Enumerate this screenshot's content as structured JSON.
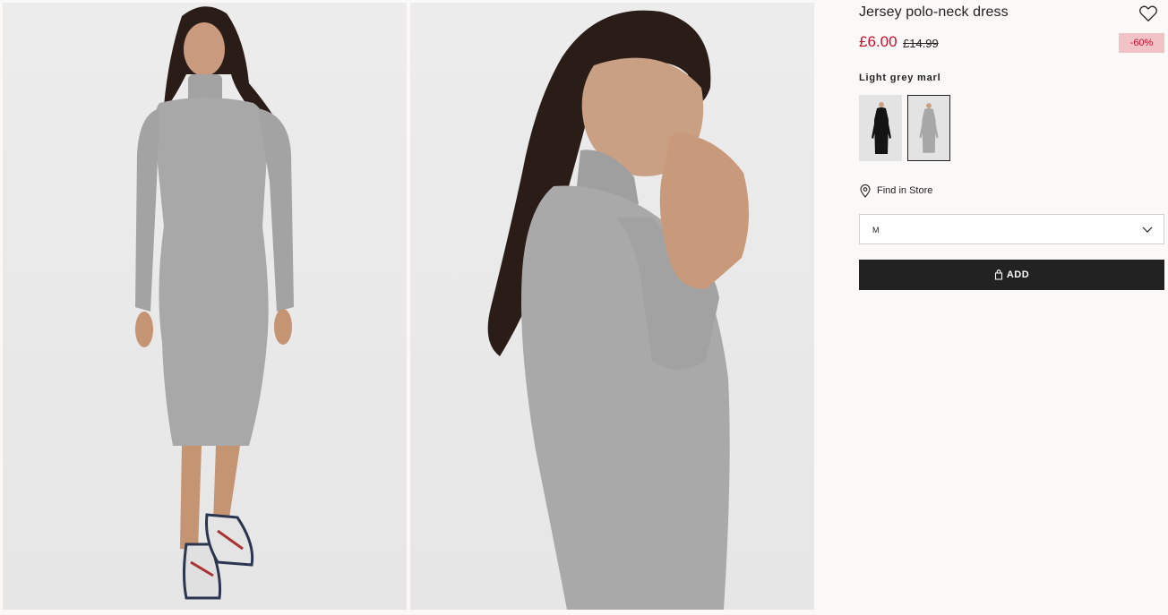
{
  "product": {
    "title": "Jersey polo-neck dress",
    "price": "£6.00",
    "original_price": "£14.99",
    "discount": "-60%",
    "color_label": "Light grey marl",
    "swatches": [
      {
        "name": "Black",
        "color": "#141414",
        "selected": false
      },
      {
        "name": "Light grey marl",
        "color": "#a7a7a7",
        "selected": true
      }
    ],
    "find_in_store": "Find in Store",
    "size_value": "M",
    "add_button": "ADD"
  },
  "colors": {
    "price_red": "#c8102e",
    "discount_bg": "#f1c3c6",
    "button_bg": "#222222",
    "page_bg": "#faf9f8"
  },
  "icons": {
    "favorite": "heart-icon",
    "location": "location-pin-icon",
    "dropdown": "chevron-down-icon",
    "bag": "shopping-bag-icon"
  }
}
